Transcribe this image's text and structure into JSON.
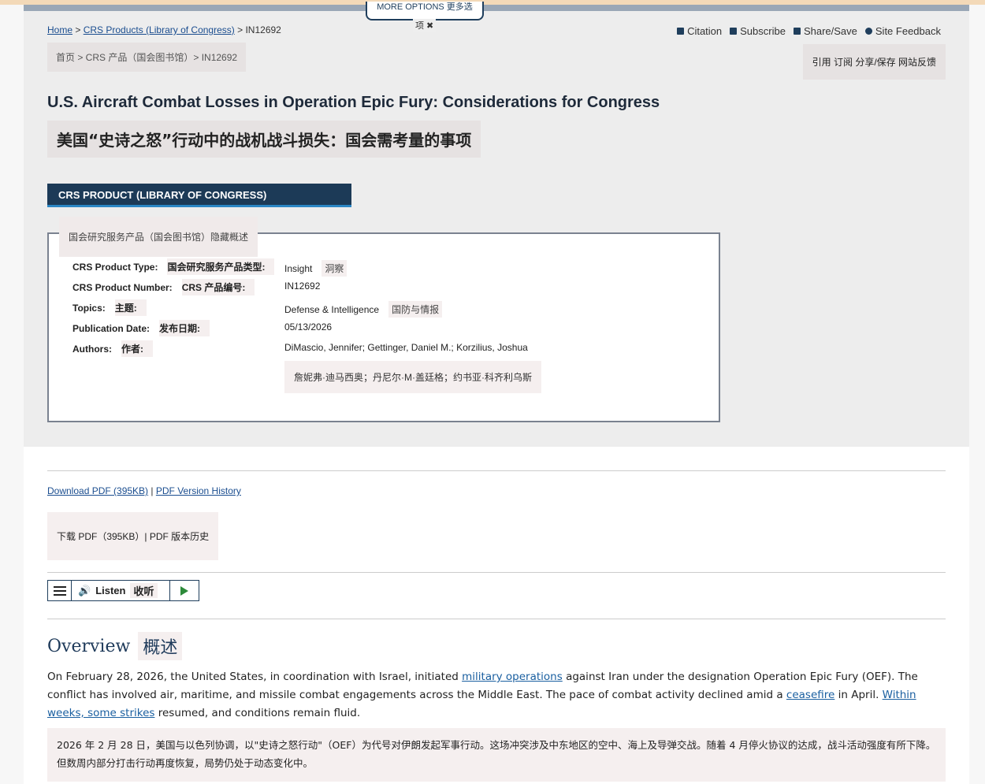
{
  "header": {
    "more_options": "MORE OPTIONS  更多选",
    "more_options_cn_tail": "项 ✖",
    "breadcrumb": {
      "home": "Home",
      "sep1": " > ",
      "crs_products": "CRS Products (Library of Congress)",
      "sep2": " > ",
      "current": "IN12692"
    },
    "breadcrumb_cn": "首页 > CRS 产品（国会图书馆）> IN12692",
    "tools": {
      "citation": "Citation",
      "subscribe": "Subscribe",
      "share_save": "Share/Save",
      "site_feedback": "Site Feedback"
    },
    "tools_cn": "引用  订阅  分享/保存  网站反馈"
  },
  "document": {
    "title": "U.S. Aircraft Combat Losses in Operation Epic Fury: Considerations for Congress",
    "title_cn": "美国“史诗之怒”行动中的战机战斗损失：国会需考量的事项",
    "product_bar": "CRS PRODUCT (LIBRARY OF CONGRESS)",
    "summary_toggle_cn": "国会研究服务产品（国会图书馆）隐藏概述",
    "info": {
      "type_label": "CRS Product Type:",
      "type_label_cn": "国会研究服务产品类型:",
      "type_value": "Insight",
      "type_value_cn": "洞察",
      "number_label": "CRS Product Number:",
      "number_label_cn": "CRS 产品编号:",
      "number_value": "IN12692",
      "topics_label": "Topics:",
      "topics_label_cn": "主题:",
      "topics_value": "Defense & Intelligence",
      "topics_value_cn": "国防与情报",
      "date_label": "Publication Date:",
      "date_label_cn": "发布日期:",
      "date_value": "05/13/2026",
      "authors_label": "Authors:",
      "authors_label_cn": "作者:",
      "authors_value": "DiMascio, Jennifer; Gettinger, Daniel M.; Korzilius, Joshua",
      "authors_value_cn": "詹妮弗·迪马西奥；丹尼尔·M·盖廷格；约书亚·科齐利乌斯"
    }
  },
  "pdf": {
    "download": "Download PDF (395KB)",
    "sep": " | ",
    "history": "PDF Version History",
    "cn": "下载 PDF（395KB）| PDF 版本历史"
  },
  "listen": {
    "label": "Listen",
    "label_cn": "收听"
  },
  "overview": {
    "heading": "Overview",
    "heading_cn": "概述",
    "p1": "On February 28, 2026, the United States, in coordination with Israel, initiated ",
    "link1": "military operations",
    "p2": " against Iran under the designation Operation Epic Fury (OEF). The conflict has involved air, maritime, and missile combat engagements across the Middle East. The pace of combat activity declined amid a ",
    "link2": "ceasefire",
    "p3": " in April. ",
    "link3": "Within weeks, some strikes",
    "p4": " resumed, and conditions remain fluid.",
    "cn": "2026 年 2 月 28 日，美国与以色列协调，以\"史诗之怒行动\"（OEF）为代号对伊朗发起军事行动。这场冲突涉及中东地区的空中、海上及导弹交战。随着 4 月停火协议的达成，战斗活动强度有所下降。但数周内部分打击行动再度恢复，局势仍处于动态变化中。"
  }
}
